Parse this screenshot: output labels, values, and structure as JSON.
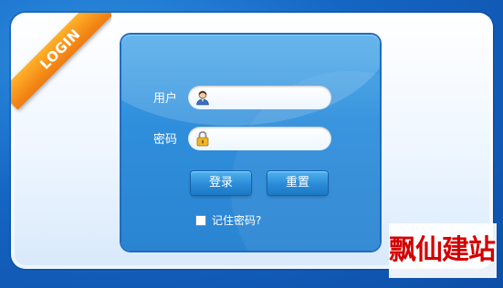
{
  "ribbon": {
    "text": "LOGIN"
  },
  "form": {
    "username_label": "用户",
    "password_label": "密码",
    "username_value": "",
    "password_value": "",
    "login_button": "登录",
    "reset_button": "重置",
    "remember_label": "记住密码?"
  },
  "icons": {
    "user": "user-icon",
    "lock": "lock-icon"
  },
  "watermark": {
    "text": "飘仙建站"
  },
  "colors": {
    "background": "#1566c4",
    "card": "#2f8fdc",
    "ribbon": "#f39018",
    "watermark": "#d40000"
  }
}
